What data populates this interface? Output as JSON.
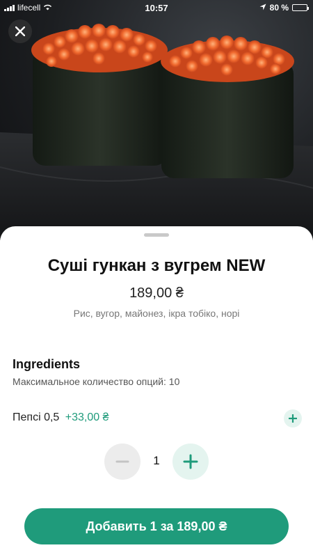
{
  "status_bar": {
    "carrier": "lifecell",
    "time": "10:57",
    "battery": "80 %",
    "battery_level": 0.8
  },
  "hero": {
    "image": "sushi-gunkan-photo"
  },
  "product": {
    "title": "Суші гункан з вугрем NEW",
    "price": "189,00 ₴",
    "description": "Рис, вугор, майонез, ікра тобіко, норі"
  },
  "ingredients": {
    "title": "Ingredients",
    "subtitle": "Максимальное количество опций: 10",
    "options": [
      {
        "label": "Пепсі 0,5",
        "price": "+33,00 ₴"
      }
    ]
  },
  "quantity": {
    "value": "1"
  },
  "cta": {
    "label": "Добавить 1 за 189,00 ₴"
  },
  "colors": {
    "accent": "#1f9b7b",
    "accent_light": "#e4f4ef"
  }
}
